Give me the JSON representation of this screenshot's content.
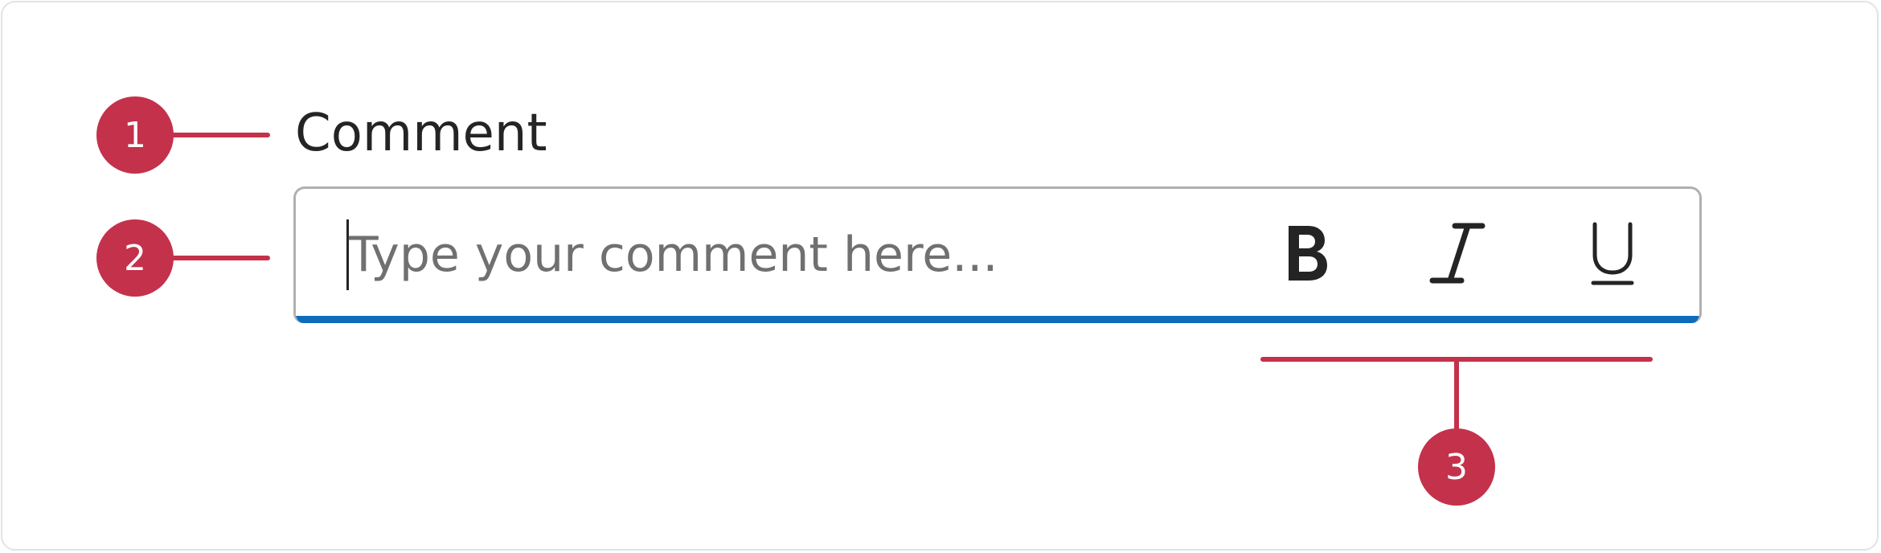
{
  "colors": {
    "accent": "#c4314b",
    "focus_underline": "#0f6cbd",
    "text": "#242424",
    "placeholder": "#707070",
    "border": "#b0b0b0"
  },
  "markers": {
    "one": "1",
    "two": "2",
    "three": "3"
  },
  "field": {
    "label": "Comment",
    "placeholder": "Type your comment here..."
  },
  "toolbar": {
    "icons": [
      "bold-icon",
      "italic-icon",
      "underline-icon"
    ]
  }
}
